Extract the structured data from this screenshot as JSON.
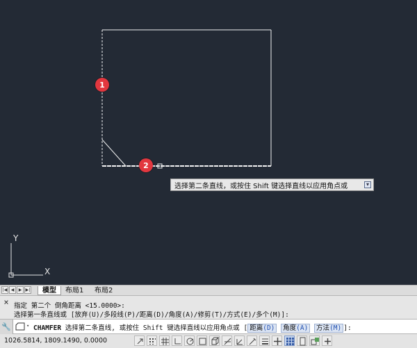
{
  "viewport": {
    "tooltip_text": "选择第二条直线，或按住 Shift 键选择直线以应用角点或",
    "markers": [
      "1",
      "2"
    ],
    "ucs": {
      "x_label": "X",
      "y_label": "Y"
    }
  },
  "layout_tabs": {
    "nav": [
      "|◀",
      "◀",
      "▶",
      "▶|"
    ],
    "tabs": [
      "模型",
      "布局1",
      "布局2"
    ],
    "active": "模型"
  },
  "command_history": {
    "close": "×",
    "lines": [
      "指定 第二个 倒角距离 <15.0000>:",
      "选择第一条直线或 [放弃(U)/多段线(P)/距离(D)/角度(A)/修剪(T)/方式(E)/多个(M)]:"
    ]
  },
  "command_line": {
    "wrench": "🔧",
    "dropdown": "▾",
    "command": "CHAMFER",
    "prompt": " 选择第二条直线, 或按住 Shift 键选择直线以应用角点或 ",
    "options": [
      {
        "label": "距离",
        "key": "(D)"
      },
      {
        "label": "角度",
        "key": "(A)"
      },
      {
        "label": "方法",
        "key": "(M)"
      }
    ],
    "suffix": "]:"
  },
  "status_bar": {
    "coordinates": "1026.5814, 1809.1490, 0.0000",
    "toggles": [
      "infer-constraints",
      "snap-mode",
      "grid-display",
      "ortho-mode",
      "polar-tracking",
      "object-snap",
      "3d-object-snap",
      "object-snap-tracking",
      "dynamic-ucs",
      "dynamic-input",
      "lineweight",
      "transparency",
      "quick-properties",
      "selection-cycling",
      "annotation-monitor"
    ],
    "colors": {
      "active": "#c7d7ef",
      "viewport_bg": "#232a35",
      "marker": "#e2373f"
    }
  }
}
